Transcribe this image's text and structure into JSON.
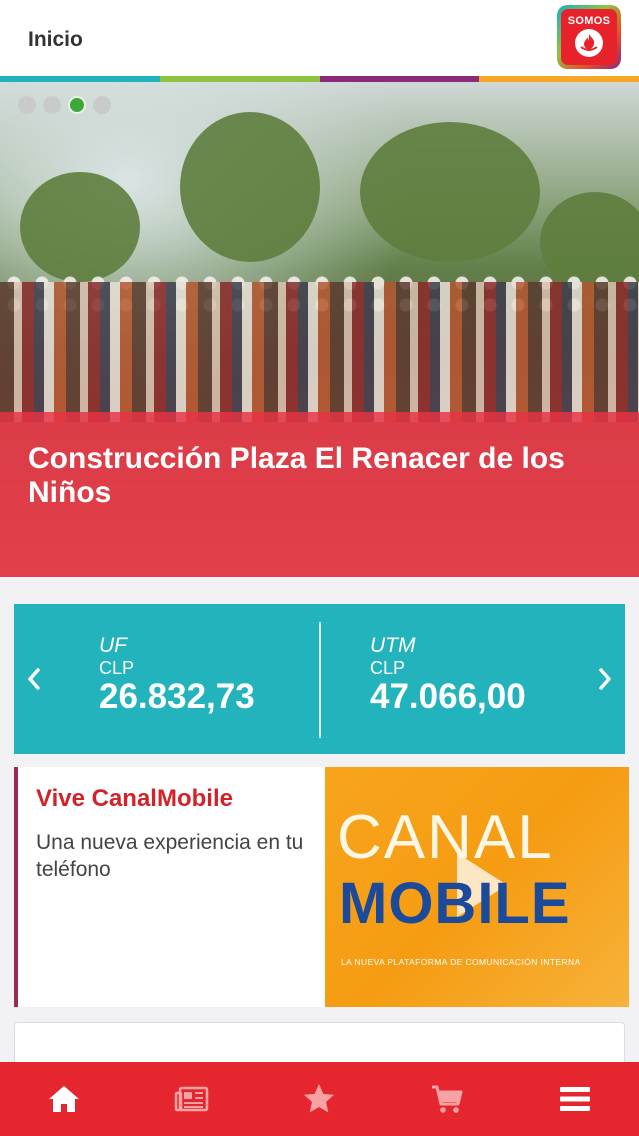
{
  "header": {
    "title": "Inicio",
    "logo_text": "SOMOS"
  },
  "stripe_colors": [
    "#22b3bd",
    "#8fc33f",
    "#8b2a7a",
    "#f5a623"
  ],
  "carousel": {
    "slide_count": 4,
    "active_index": 2,
    "title": "Construcción Plaza El Renacer de los Niños"
  },
  "indicators": {
    "items": [
      {
        "name": "UF",
        "currency": "CLP",
        "value": "26.832,73"
      },
      {
        "name": "UTM",
        "currency": "CLP",
        "value": "47.066,00"
      }
    ],
    "prev_icon": "chevron-left-icon",
    "next_icon": "chevron-right-icon"
  },
  "canal_card": {
    "title": "Vive CanalMobile",
    "description": "Una nueva experiencia en tu teléfono",
    "image_line1": "CANAL",
    "image_line2": "MOBILE",
    "image_tagline": "LA NUEVA PLATAFORMA DE COMUNICACIÓN INTERNA"
  },
  "bottom_nav": [
    {
      "icon": "home-icon",
      "active": true
    },
    {
      "icon": "news-icon",
      "active": false
    },
    {
      "icon": "star-icon",
      "active": false
    },
    {
      "icon": "cart-icon",
      "active": false
    },
    {
      "icon": "menu-icon",
      "active": true
    }
  ],
  "colors": {
    "brand_red": "#e6262e",
    "teal": "#22b3bd",
    "card_title_red": "#d2232a",
    "card_accent": "#9b2a58"
  }
}
